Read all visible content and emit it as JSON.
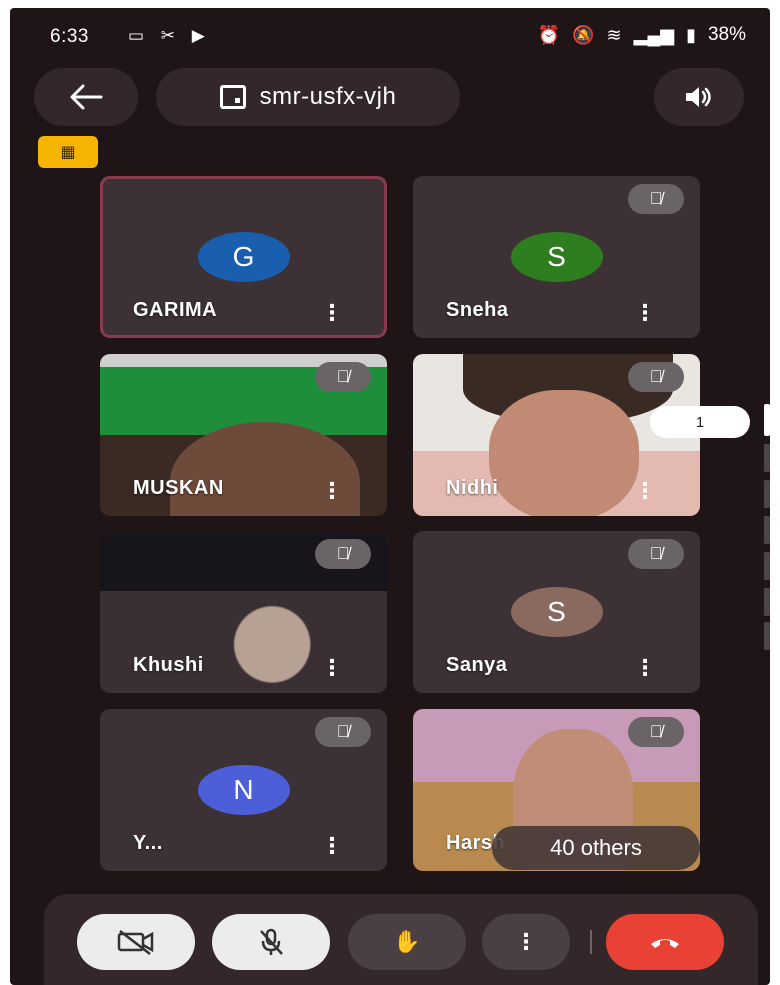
{
  "status_bar": {
    "time": "6:33",
    "left_icons": "▭ ✂ ▶",
    "battery": "38%"
  },
  "header": {
    "meeting_code": "smr-usfx-vjh"
  },
  "participants": [
    {
      "name": "GARIMA",
      "initial": "G",
      "avatar_color": "#1a5fae",
      "muted": false,
      "active": true,
      "video": false
    },
    {
      "name": "Sneha",
      "initial": "S",
      "avatar_color": "#2e7d1e",
      "muted": true,
      "video": false
    },
    {
      "name": "MUSKAN",
      "muted": true,
      "video": true
    },
    {
      "name": "Nidhi",
      "muted": true,
      "video": true
    },
    {
      "name": "Khushi",
      "muted": true,
      "video": true
    },
    {
      "name": "Sanya",
      "initial": "S",
      "avatar_color": "#8a6a5e",
      "muted": true,
      "video": false
    },
    {
      "name": "Y...",
      "initial": "N",
      "avatar_color": "#4d5fd8",
      "muted": true,
      "video": false
    },
    {
      "name": "Harsh",
      "muted": true,
      "video": true
    }
  ],
  "others_label": "40 others",
  "page_indicator": "1",
  "controls": {
    "end_color": "#e94235"
  }
}
